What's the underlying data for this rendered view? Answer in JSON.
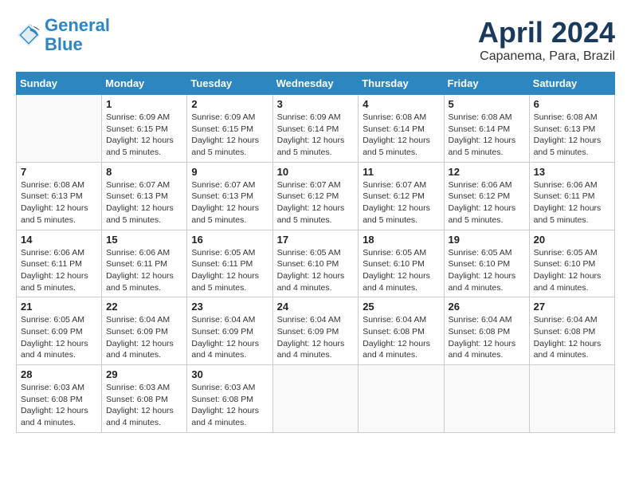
{
  "logo": {
    "line1": "General",
    "line2": "Blue"
  },
  "title": "April 2024",
  "location": "Capanema, Para, Brazil",
  "weekdays": [
    "Sunday",
    "Monday",
    "Tuesday",
    "Wednesday",
    "Thursday",
    "Friday",
    "Saturday"
  ],
  "weeks": [
    [
      {
        "day": "",
        "info": ""
      },
      {
        "day": "1",
        "info": "Sunrise: 6:09 AM\nSunset: 6:15 PM\nDaylight: 12 hours and 5 minutes."
      },
      {
        "day": "2",
        "info": "Sunrise: 6:09 AM\nSunset: 6:15 PM\nDaylight: 12 hours and 5 minutes."
      },
      {
        "day": "3",
        "info": "Sunrise: 6:09 AM\nSunset: 6:14 PM\nDaylight: 12 hours and 5 minutes."
      },
      {
        "day": "4",
        "info": "Sunrise: 6:08 AM\nSunset: 6:14 PM\nDaylight: 12 hours and 5 minutes."
      },
      {
        "day": "5",
        "info": "Sunrise: 6:08 AM\nSunset: 6:14 PM\nDaylight: 12 hours and 5 minutes."
      },
      {
        "day": "6",
        "info": "Sunrise: 6:08 AM\nSunset: 6:13 PM\nDaylight: 12 hours and 5 minutes."
      }
    ],
    [
      {
        "day": "7",
        "info": "Sunrise: 6:08 AM\nSunset: 6:13 PM\nDaylight: 12 hours and 5 minutes."
      },
      {
        "day": "8",
        "info": "Sunrise: 6:07 AM\nSunset: 6:13 PM\nDaylight: 12 hours and 5 minutes."
      },
      {
        "day": "9",
        "info": "Sunrise: 6:07 AM\nSunset: 6:13 PM\nDaylight: 12 hours and 5 minutes."
      },
      {
        "day": "10",
        "info": "Sunrise: 6:07 AM\nSunset: 6:12 PM\nDaylight: 12 hours and 5 minutes."
      },
      {
        "day": "11",
        "info": "Sunrise: 6:07 AM\nSunset: 6:12 PM\nDaylight: 12 hours and 5 minutes."
      },
      {
        "day": "12",
        "info": "Sunrise: 6:06 AM\nSunset: 6:12 PM\nDaylight: 12 hours and 5 minutes."
      },
      {
        "day": "13",
        "info": "Sunrise: 6:06 AM\nSunset: 6:11 PM\nDaylight: 12 hours and 5 minutes."
      }
    ],
    [
      {
        "day": "14",
        "info": "Sunrise: 6:06 AM\nSunset: 6:11 PM\nDaylight: 12 hours and 5 minutes."
      },
      {
        "day": "15",
        "info": "Sunrise: 6:06 AM\nSunset: 6:11 PM\nDaylight: 12 hours and 5 minutes."
      },
      {
        "day": "16",
        "info": "Sunrise: 6:05 AM\nSunset: 6:11 PM\nDaylight: 12 hours and 5 minutes."
      },
      {
        "day": "17",
        "info": "Sunrise: 6:05 AM\nSunset: 6:10 PM\nDaylight: 12 hours and 4 minutes."
      },
      {
        "day": "18",
        "info": "Sunrise: 6:05 AM\nSunset: 6:10 PM\nDaylight: 12 hours and 4 minutes."
      },
      {
        "day": "19",
        "info": "Sunrise: 6:05 AM\nSunset: 6:10 PM\nDaylight: 12 hours and 4 minutes."
      },
      {
        "day": "20",
        "info": "Sunrise: 6:05 AM\nSunset: 6:10 PM\nDaylight: 12 hours and 4 minutes."
      }
    ],
    [
      {
        "day": "21",
        "info": "Sunrise: 6:05 AM\nSunset: 6:09 PM\nDaylight: 12 hours and 4 minutes."
      },
      {
        "day": "22",
        "info": "Sunrise: 6:04 AM\nSunset: 6:09 PM\nDaylight: 12 hours and 4 minutes."
      },
      {
        "day": "23",
        "info": "Sunrise: 6:04 AM\nSunset: 6:09 PM\nDaylight: 12 hours and 4 minutes."
      },
      {
        "day": "24",
        "info": "Sunrise: 6:04 AM\nSunset: 6:09 PM\nDaylight: 12 hours and 4 minutes."
      },
      {
        "day": "25",
        "info": "Sunrise: 6:04 AM\nSunset: 6:08 PM\nDaylight: 12 hours and 4 minutes."
      },
      {
        "day": "26",
        "info": "Sunrise: 6:04 AM\nSunset: 6:08 PM\nDaylight: 12 hours and 4 minutes."
      },
      {
        "day": "27",
        "info": "Sunrise: 6:04 AM\nSunset: 6:08 PM\nDaylight: 12 hours and 4 minutes."
      }
    ],
    [
      {
        "day": "28",
        "info": "Sunrise: 6:03 AM\nSunset: 6:08 PM\nDaylight: 12 hours and 4 minutes."
      },
      {
        "day": "29",
        "info": "Sunrise: 6:03 AM\nSunset: 6:08 PM\nDaylight: 12 hours and 4 minutes."
      },
      {
        "day": "30",
        "info": "Sunrise: 6:03 AM\nSunset: 6:08 PM\nDaylight: 12 hours and 4 minutes."
      },
      {
        "day": "",
        "info": ""
      },
      {
        "day": "",
        "info": ""
      },
      {
        "day": "",
        "info": ""
      },
      {
        "day": "",
        "info": ""
      }
    ]
  ]
}
